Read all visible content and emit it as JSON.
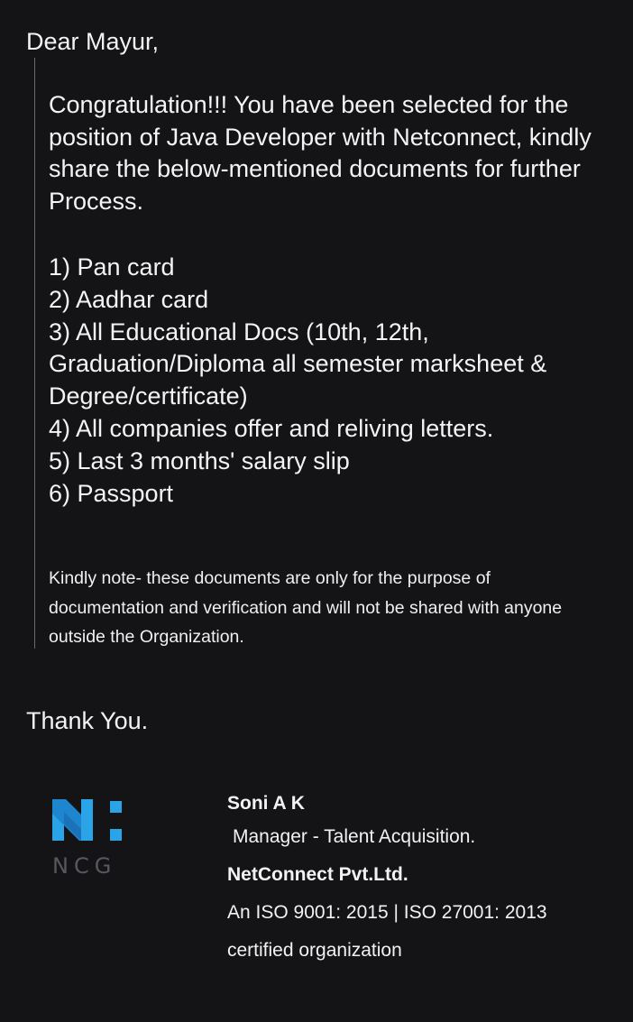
{
  "greeting": "Dear Mayur,",
  "message": {
    "paragraph": "Congratulation!!! You have been selected for the position of  Java Developer with Netconnect, kindly share the below-mentioned documents for further Process.",
    "documents": [
      "1) Pan card",
      "2) Aadhar card",
      "3) All Educational Docs (10th, 12th, Graduation/Diploma all semester marksheet & Degree/certificate)",
      "4) All companies offer and reliving letters.",
      "5) Last 3 months' salary slip",
      "6) Passport"
    ],
    "note": "Kindly note- these documents are only for the purpose of documentation and verification and will not be shared with anyone outside the Organization."
  },
  "closing": "Thank You.",
  "logo": {
    "icon": "ncg-logo-icon",
    "text": "NCG",
    "colors": {
      "blue": "#2aa4e6",
      "dark_blue": "#1a73b8",
      "gray": "#55595f"
    }
  },
  "signature": {
    "name": "Soni A K",
    "title": "Manager - Talent Acquisition.",
    "company": "NetConnect Pvt.Ltd.",
    "iso": "An ISO 9001: 2015 | ISO 27001: 2013",
    "certified": "certified organization"
  },
  "colors": {
    "background": "#141416",
    "text": "#f3f3f3",
    "quote_bar": "#6a6a6a"
  }
}
